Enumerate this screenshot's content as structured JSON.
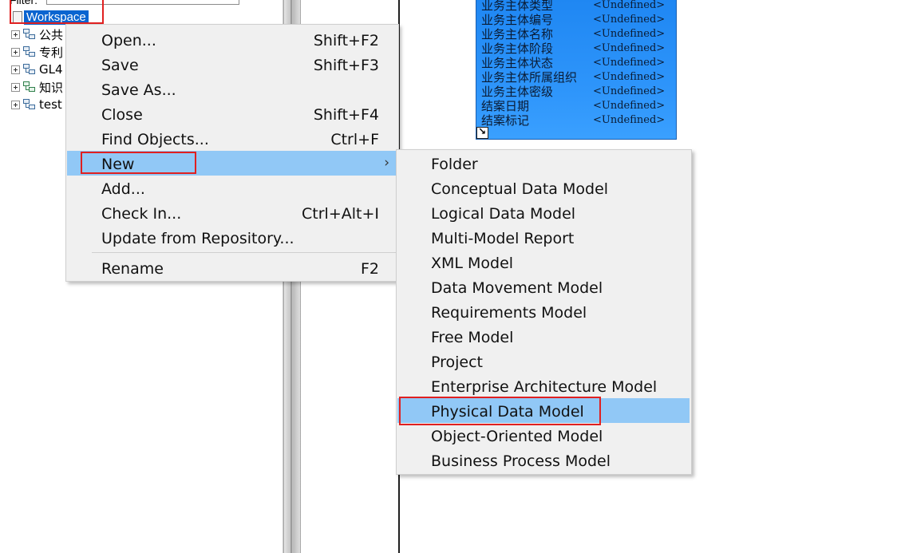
{
  "browser": {
    "filter_label": "Filter:",
    "filter_value": "",
    "clear_glyph": "✖",
    "refresh_glyph": "⟳",
    "workspace_label": "Workspace",
    "tree_items": [
      {
        "label": "公共",
        "icon": "model-icon"
      },
      {
        "label": "专利",
        "icon": "model-icon"
      },
      {
        "label": "GL4",
        "icon": "model-icon"
      },
      {
        "label": "知识",
        "icon": "model-green-icon"
      },
      {
        "label": "test",
        "icon": "model-icon"
      }
    ]
  },
  "entity": {
    "rows": [
      {
        "key": "业务主体类型",
        "value": "<Undefined>"
      },
      {
        "key": "业务主体编号",
        "value": "<Undefined>"
      },
      {
        "key": "业务主体名称",
        "value": "<Undefined>"
      },
      {
        "key": "业务主体阶段",
        "value": "<Undefined>"
      },
      {
        "key": "业务主体状态",
        "value": "<Undefined>"
      },
      {
        "key": "业务主体所属组织",
        "value": "<Undefined>"
      },
      {
        "key": "业务主体密级",
        "value": "<Undefined>"
      },
      {
        "key": "结案日期",
        "value": "<Undefined>"
      },
      {
        "key": "结案标记",
        "value": "<Undefined>"
      }
    ]
  },
  "context_menu": {
    "items": [
      {
        "label": "Open...",
        "shortcut": "Shift+F2"
      },
      {
        "label": "Save",
        "shortcut": "Shift+F3"
      },
      {
        "label": "Save As...",
        "shortcut": ""
      },
      {
        "label": "Close",
        "shortcut": "Shift+F4"
      },
      {
        "label": "Find Objects...",
        "shortcut": "Ctrl+F"
      },
      {
        "label": "New",
        "shortcut": "",
        "submenu_arrow": "›"
      },
      {
        "label": "Add...",
        "shortcut": ""
      },
      {
        "label": "Check In...",
        "shortcut": "Ctrl+Alt+I"
      },
      {
        "label": "Update from Repository...",
        "shortcut": ""
      },
      {
        "label": "Rename",
        "shortcut": "F2"
      }
    ]
  },
  "new_submenu": {
    "items": [
      "Folder",
      "Conceptual Data Model",
      "Logical Data Model",
      "Multi-Model Report",
      "XML Model",
      "Data Movement Model",
      "Requirements Model",
      "Free Model",
      "Project",
      "Enterprise Architecture Model",
      "Physical Data Model",
      "Object-Oriented Model",
      "Business Process Model"
    ]
  },
  "colors": {
    "menu_highlight": "#91c8f6",
    "annotation_red": "#e02020",
    "entity_blue": "#2f96fb",
    "selection_blue": "#0a64d0"
  }
}
